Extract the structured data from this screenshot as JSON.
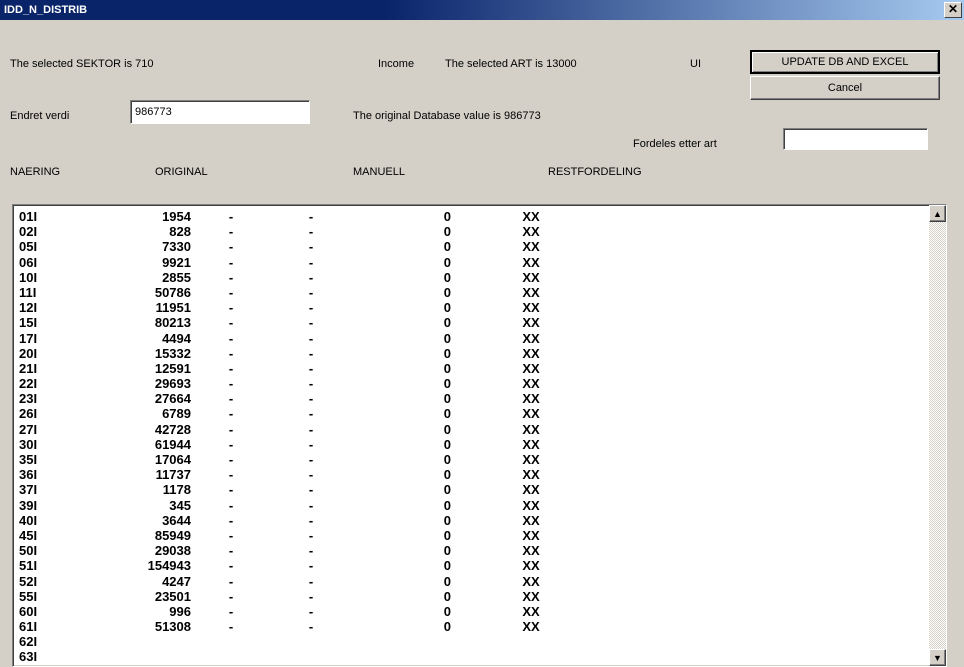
{
  "window": {
    "title": "IDD_N_DISTRIB"
  },
  "info": {
    "sektor_label": "The selected SEKTOR is 710",
    "income_label": "Income",
    "art_label": "The selected ART is 13000",
    "ui_label": "UI",
    "endret_label": "Endret verdi",
    "endret_value": "986773",
    "orig_db_label": "The original Database value is 986773",
    "fordeles_label": "Fordeles etter art",
    "fordeles_value": ""
  },
  "buttons": {
    "update": "UPDATE DB AND EXCEL",
    "cancel": "Cancel",
    "close": "X"
  },
  "headers": {
    "naering": "NAERING",
    "original": "ORIGINAL",
    "manuell": "MANUELL",
    "rest": "RESTFORDELING"
  },
  "rows": [
    {
      "code": "01I",
      "orig": "1954",
      "d1": "-",
      "d2": "-",
      "zero": "0",
      "xx": "XX"
    },
    {
      "code": "02I",
      "orig": "828",
      "d1": "-",
      "d2": "-",
      "zero": "0",
      "xx": "XX"
    },
    {
      "code": "05I",
      "orig": "7330",
      "d1": "-",
      "d2": "-",
      "zero": "0",
      "xx": "XX"
    },
    {
      "code": "06I",
      "orig": "9921",
      "d1": "-",
      "d2": "-",
      "zero": "0",
      "xx": "XX"
    },
    {
      "code": "10I",
      "orig": "2855",
      "d1": "-",
      "d2": "-",
      "zero": "0",
      "xx": "XX"
    },
    {
      "code": "11I",
      "orig": "50786",
      "d1": "-",
      "d2": "-",
      "zero": "0",
      "xx": "XX"
    },
    {
      "code": "12I",
      "orig": "11951",
      "d1": "-",
      "d2": "-",
      "zero": "0",
      "xx": "XX"
    },
    {
      "code": "15I",
      "orig": "80213",
      "d1": "-",
      "d2": "-",
      "zero": "0",
      "xx": "XX"
    },
    {
      "code": "17I",
      "orig": "4494",
      "d1": "-",
      "d2": "-",
      "zero": "0",
      "xx": "XX"
    },
    {
      "code": "20I",
      "orig": "15332",
      "d1": "-",
      "d2": "-",
      "zero": "0",
      "xx": "XX"
    },
    {
      "code": "21I",
      "orig": "12591",
      "d1": "-",
      "d2": "-",
      "zero": "0",
      "xx": "XX"
    },
    {
      "code": "22I",
      "orig": "29693",
      "d1": "-",
      "d2": "-",
      "zero": "0",
      "xx": "XX"
    },
    {
      "code": "23I",
      "orig": "27664",
      "d1": "-",
      "d2": "-",
      "zero": "0",
      "xx": "XX"
    },
    {
      "code": "26I",
      "orig": "6789",
      "d1": "-",
      "d2": "-",
      "zero": "0",
      "xx": "XX"
    },
    {
      "code": "27I",
      "orig": "42728",
      "d1": "-",
      "d2": "-",
      "zero": "0",
      "xx": "XX"
    },
    {
      "code": "30I",
      "orig": "61944",
      "d1": "-",
      "d2": "-",
      "zero": "0",
      "xx": "XX"
    },
    {
      "code": "35I",
      "orig": "17064",
      "d1": "-",
      "d2": "-",
      "zero": "0",
      "xx": "XX"
    },
    {
      "code": "36I",
      "orig": "11737",
      "d1": "-",
      "d2": "-",
      "zero": "0",
      "xx": "XX"
    },
    {
      "code": "37I",
      "orig": "1178",
      "d1": "-",
      "d2": "-",
      "zero": "0",
      "xx": "XX"
    },
    {
      "code": "39I",
      "orig": "345",
      "d1": "-",
      "d2": "-",
      "zero": "0",
      "xx": "XX"
    },
    {
      "code": "40I",
      "orig": "3644",
      "d1": "-",
      "d2": "-",
      "zero": "0",
      "xx": "XX"
    },
    {
      "code": "45I",
      "orig": "85949",
      "d1": "-",
      "d2": "-",
      "zero": "0",
      "xx": "XX"
    },
    {
      "code": "50I",
      "orig": "29038",
      "d1": "-",
      "d2": "-",
      "zero": "0",
      "xx": "XX"
    },
    {
      "code": "51I",
      "orig": "154943",
      "d1": "-",
      "d2": "-",
      "zero": "0",
      "xx": "XX"
    },
    {
      "code": "52I",
      "orig": "4247",
      "d1": "-",
      "d2": "-",
      "zero": "0",
      "xx": "XX"
    },
    {
      "code": "55I",
      "orig": "23501",
      "d1": "-",
      "d2": "-",
      "zero": "0",
      "xx": "XX"
    },
    {
      "code": "60I",
      "orig": "996",
      "d1": "-",
      "d2": "-",
      "zero": "0",
      "xx": "XX"
    },
    {
      "code": "61I",
      "orig": "51308",
      "d1": "-",
      "d2": "-",
      "zero": "0",
      "xx": "XX"
    },
    {
      "code": "62I",
      "orig": "",
      "d1": "",
      "d2": "",
      "zero": "",
      "xx": ""
    },
    {
      "code": "63I",
      "orig": "",
      "d1": "",
      "d2": "",
      "zero": "",
      "xx": ""
    }
  ]
}
